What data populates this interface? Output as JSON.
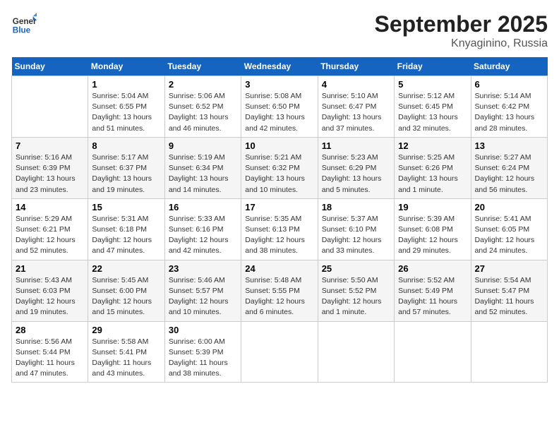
{
  "header": {
    "logo_general": "General",
    "logo_blue": "Blue",
    "month": "September 2025",
    "location": "Knyaginino, Russia"
  },
  "weekdays": [
    "Sunday",
    "Monday",
    "Tuesday",
    "Wednesday",
    "Thursday",
    "Friday",
    "Saturday"
  ],
  "weeks": [
    [
      {
        "day": "",
        "info": ""
      },
      {
        "day": "1",
        "info": "Sunrise: 5:04 AM\nSunset: 6:55 PM\nDaylight: 13 hours\nand 51 minutes."
      },
      {
        "day": "2",
        "info": "Sunrise: 5:06 AM\nSunset: 6:52 PM\nDaylight: 13 hours\nand 46 minutes."
      },
      {
        "day": "3",
        "info": "Sunrise: 5:08 AM\nSunset: 6:50 PM\nDaylight: 13 hours\nand 42 minutes."
      },
      {
        "day": "4",
        "info": "Sunrise: 5:10 AM\nSunset: 6:47 PM\nDaylight: 13 hours\nand 37 minutes."
      },
      {
        "day": "5",
        "info": "Sunrise: 5:12 AM\nSunset: 6:45 PM\nDaylight: 13 hours\nand 32 minutes."
      },
      {
        "day": "6",
        "info": "Sunrise: 5:14 AM\nSunset: 6:42 PM\nDaylight: 13 hours\nand 28 minutes."
      }
    ],
    [
      {
        "day": "7",
        "info": "Sunrise: 5:16 AM\nSunset: 6:39 PM\nDaylight: 13 hours\nand 23 minutes."
      },
      {
        "day": "8",
        "info": "Sunrise: 5:17 AM\nSunset: 6:37 PM\nDaylight: 13 hours\nand 19 minutes."
      },
      {
        "day": "9",
        "info": "Sunrise: 5:19 AM\nSunset: 6:34 PM\nDaylight: 13 hours\nand 14 minutes."
      },
      {
        "day": "10",
        "info": "Sunrise: 5:21 AM\nSunset: 6:32 PM\nDaylight: 13 hours\nand 10 minutes."
      },
      {
        "day": "11",
        "info": "Sunrise: 5:23 AM\nSunset: 6:29 PM\nDaylight: 13 hours\nand 5 minutes."
      },
      {
        "day": "12",
        "info": "Sunrise: 5:25 AM\nSunset: 6:26 PM\nDaylight: 13 hours\nand 1 minute."
      },
      {
        "day": "13",
        "info": "Sunrise: 5:27 AM\nSunset: 6:24 PM\nDaylight: 12 hours\nand 56 minutes."
      }
    ],
    [
      {
        "day": "14",
        "info": "Sunrise: 5:29 AM\nSunset: 6:21 PM\nDaylight: 12 hours\nand 52 minutes."
      },
      {
        "day": "15",
        "info": "Sunrise: 5:31 AM\nSunset: 6:18 PM\nDaylight: 12 hours\nand 47 minutes."
      },
      {
        "day": "16",
        "info": "Sunrise: 5:33 AM\nSunset: 6:16 PM\nDaylight: 12 hours\nand 42 minutes."
      },
      {
        "day": "17",
        "info": "Sunrise: 5:35 AM\nSunset: 6:13 PM\nDaylight: 12 hours\nand 38 minutes."
      },
      {
        "day": "18",
        "info": "Sunrise: 5:37 AM\nSunset: 6:10 PM\nDaylight: 12 hours\nand 33 minutes."
      },
      {
        "day": "19",
        "info": "Sunrise: 5:39 AM\nSunset: 6:08 PM\nDaylight: 12 hours\nand 29 minutes."
      },
      {
        "day": "20",
        "info": "Sunrise: 5:41 AM\nSunset: 6:05 PM\nDaylight: 12 hours\nand 24 minutes."
      }
    ],
    [
      {
        "day": "21",
        "info": "Sunrise: 5:43 AM\nSunset: 6:03 PM\nDaylight: 12 hours\nand 19 minutes."
      },
      {
        "day": "22",
        "info": "Sunrise: 5:45 AM\nSunset: 6:00 PM\nDaylight: 12 hours\nand 15 minutes."
      },
      {
        "day": "23",
        "info": "Sunrise: 5:46 AM\nSunset: 5:57 PM\nDaylight: 12 hours\nand 10 minutes."
      },
      {
        "day": "24",
        "info": "Sunrise: 5:48 AM\nSunset: 5:55 PM\nDaylight: 12 hours\nand 6 minutes."
      },
      {
        "day": "25",
        "info": "Sunrise: 5:50 AM\nSunset: 5:52 PM\nDaylight: 12 hours\nand 1 minute."
      },
      {
        "day": "26",
        "info": "Sunrise: 5:52 AM\nSunset: 5:49 PM\nDaylight: 11 hours\nand 57 minutes."
      },
      {
        "day": "27",
        "info": "Sunrise: 5:54 AM\nSunset: 5:47 PM\nDaylight: 11 hours\nand 52 minutes."
      }
    ],
    [
      {
        "day": "28",
        "info": "Sunrise: 5:56 AM\nSunset: 5:44 PM\nDaylight: 11 hours\nand 47 minutes."
      },
      {
        "day": "29",
        "info": "Sunrise: 5:58 AM\nSunset: 5:41 PM\nDaylight: 11 hours\nand 43 minutes."
      },
      {
        "day": "30",
        "info": "Sunrise: 6:00 AM\nSunset: 5:39 PM\nDaylight: 11 hours\nand 38 minutes."
      },
      {
        "day": "",
        "info": ""
      },
      {
        "day": "",
        "info": ""
      },
      {
        "day": "",
        "info": ""
      },
      {
        "day": "",
        "info": ""
      }
    ]
  ]
}
